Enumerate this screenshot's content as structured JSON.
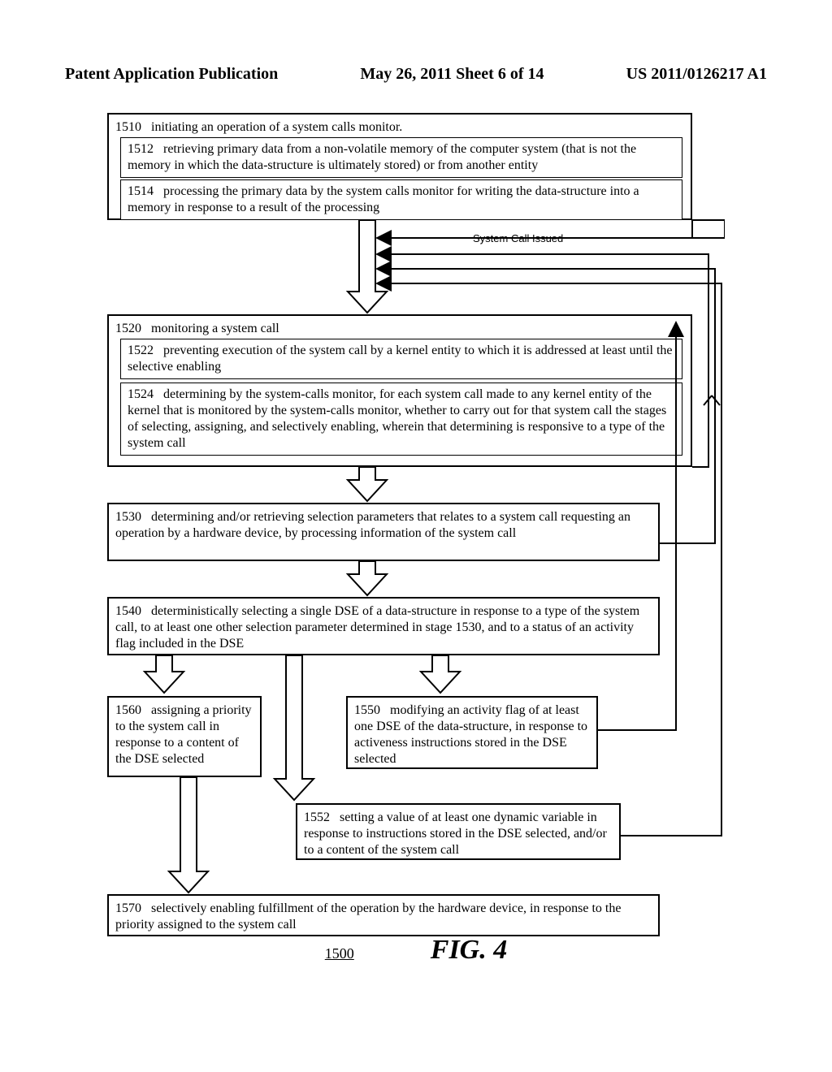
{
  "header": {
    "left": "Patent Application Publication",
    "center": "May 26, 2011  Sheet 6 of 14",
    "right": "US 2011/0126217 A1"
  },
  "labels": {
    "system_call_issued": "System Call Issued"
  },
  "steps": {
    "s1510": {
      "num": "1510",
      "text": "initiating an operation of a system calls monitor."
    },
    "s1512": {
      "num": "1512",
      "text": "retrieving primary data from a non-volatile memory of the computer system (that is not the memory in which the data-structure is ultimately stored) or from another entity"
    },
    "s1514": {
      "num": "1514",
      "text": "processing the primary data by the system calls monitor for writing the data-structure into a memory in response to a result of the processing"
    },
    "s1520": {
      "num": "1520",
      "text": "monitoring a system call"
    },
    "s1522": {
      "num": "1522",
      "text": "preventing execution of the system call by a kernel entity to which it is addressed at least until the selective enabling"
    },
    "s1524": {
      "num": "1524",
      "text": "determining by the system-calls monitor, for each system call made to any kernel entity of the kernel that is monitored by the system-calls monitor, whether to carry out for that system call the stages of selecting, assigning, and selectively enabling, wherein that determining is responsive to a type of the system call"
    },
    "s1530": {
      "num": "1530",
      "text": "determining and/or retrieving selection parameters that relates to a system call requesting an operation by a hardware device, by processing information of the system call"
    },
    "s1540": {
      "num": "1540",
      "text": "deterministically selecting a single DSE of a data-structure in response to a type of the system call, to at least one other selection parameter determined in stage 1530, and to a status of an activity flag included in the DSE"
    },
    "s1550": {
      "num": "1550",
      "text": "modifying an activity flag of at least one DSE of the data-structure, in response to activeness instructions stored in the DSE selected"
    },
    "s1552": {
      "num": "1552",
      "text": "setting a value of at least one dynamic variable in response to instructions stored in the DSE selected, and/or to a content of the system call"
    },
    "s1560": {
      "num": "1560",
      "text": "assigning a priority to the system call in response to a content of the DSE selected"
    },
    "s1570": {
      "num": "1570",
      "text": "selectively enabling fulfillment of the operation by the hardware device, in response to the priority assigned to the system call"
    }
  },
  "figure": {
    "ref": "1500",
    "caption": "FIG. 4"
  }
}
